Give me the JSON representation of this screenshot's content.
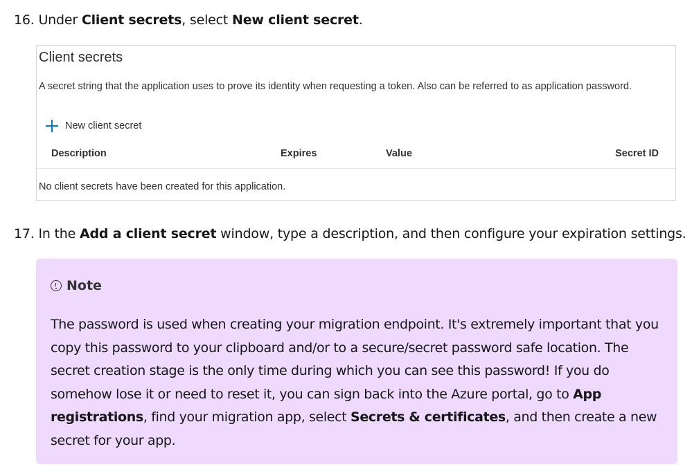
{
  "step16": {
    "number": "16.",
    "text_1": "Under ",
    "bold_1": "Client secrets",
    "text_2": ", select ",
    "bold_2": "New client secret",
    "text_3": "."
  },
  "client_secrets_panel": {
    "title": "Client secrets",
    "description": "A secret string that the application uses to prove its identity when requesting a token. Also can be referred to as application password.",
    "new_secret_button": "New client secret",
    "columns": [
      "Description",
      "Expires",
      "Value",
      "Secret ID"
    ],
    "empty_message": "No client secrets have been created for this application."
  },
  "step17": {
    "number": "17.",
    "text_1": "In the ",
    "bold_1": "Add a client secret",
    "text_2": " window, type a description, and then configure your expiration settings."
  },
  "note": {
    "heading": "Note",
    "text_1": "The password is used when creating your migration endpoint. It's extremely important that you copy this password to your clipboard and/or to a secure/secret password safe location. The secret creation stage is the only time during which you can see this password! If you do somehow lose it or need to reset it, you can sign back into the Azure portal, go to ",
    "bold_1": "App registrations",
    "text_2": ", find your migration app, select ",
    "bold_2": "Secrets & certificates",
    "text_3": ", and then create a new secret for your app.",
    "background": "#efd9fd",
    "icon": "info-icon"
  },
  "colors": {
    "accent": "#0078d4"
  },
  "icons": {
    "new_secret": "plus-icon"
  }
}
